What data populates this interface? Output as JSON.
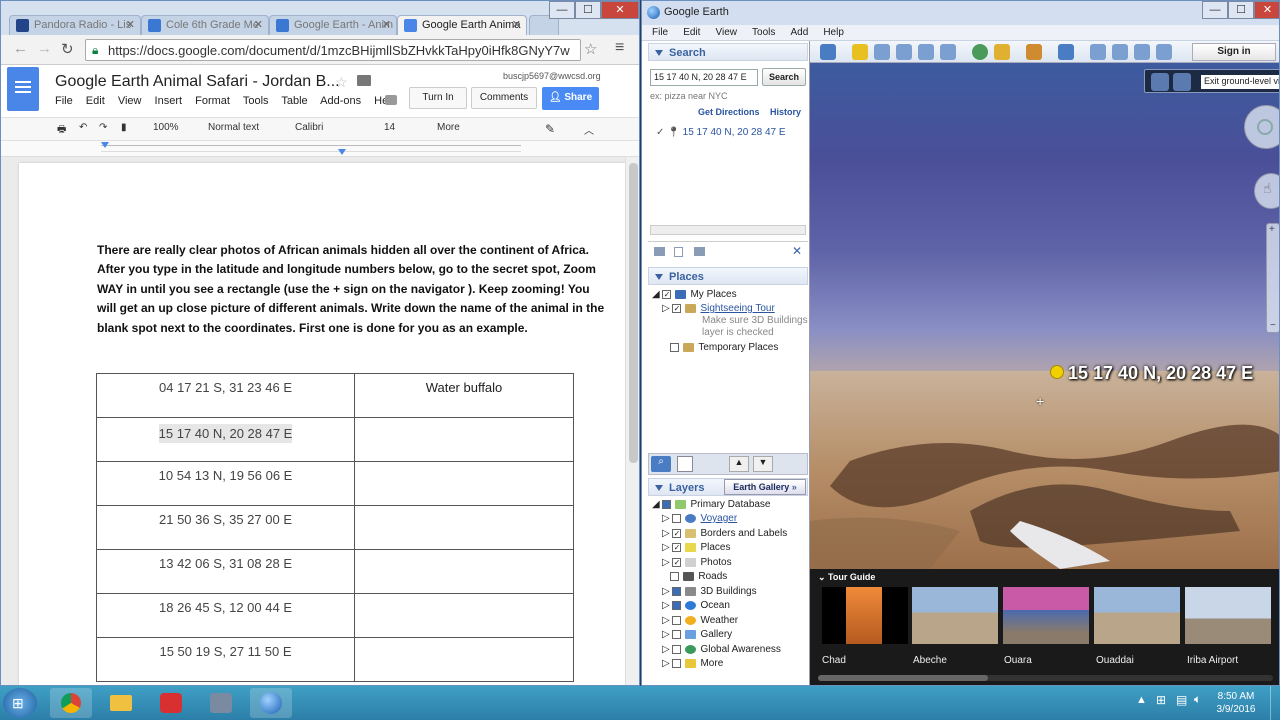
{
  "chrome": {
    "tabs": [
      {
        "label": "Pandora Radio - Lis",
        "color": "#224488"
      },
      {
        "label": "Cole 6th Grade Me",
        "color": "#3b78d4"
      },
      {
        "label": "Google Earth - Anim",
        "color": "#3b78d4"
      },
      {
        "label": "Google Earth Anima",
        "color": "#4a86e8"
      }
    ],
    "url": "https://docs.google.com/document/d/1mzcBHijmllSbZHvkkTaHpy0iHfk8GNyY7w"
  },
  "doc": {
    "title": "Google Earth Animal Safari - Jordan B...",
    "user_email": "buscjp5697@wwcsd.org",
    "menu": [
      "File",
      "Edit",
      "View",
      "Insert",
      "Format",
      "Tools",
      "Table",
      "Add-ons",
      "Hel"
    ],
    "turn_in_label": "Turn In",
    "comments_label": "Comments",
    "share_label": "Share",
    "toolbar": {
      "zoom": "100%",
      "style": "Normal text",
      "font": "Calibri",
      "size": "14",
      "more": "More"
    },
    "instructions": [
      "There are really clear photos of African animals hidden all over the continent of Africa.",
      "After you type in the latitude and longitude numbers below, go to the secret spot, Zoom",
      "WAY in until you see a rectangle (use the + sign on the navigator ). Keep zooming! You",
      "will get an up close picture of different animals.  Write down the name of the animal in the",
      "blank spot next to the coordinates.  First one is done for you as an example."
    ],
    "table_rows": [
      {
        "coord": "04 17 21 S, 31 23 46 E",
        "animal": "Water buffalo"
      },
      {
        "coord": "15 17 40 N, 20 28 47 E",
        "animal": ""
      },
      {
        "coord": "10 54 13 N, 19 56 06 E",
        "animal": ""
      },
      {
        "coord": "21 50 36 S, 35 27 00 E",
        "animal": ""
      },
      {
        "coord": "13 42 06 S, 31 08 28 E",
        "animal": ""
      },
      {
        "coord": "18 26 45 S, 12 00 44 E",
        "animal": ""
      },
      {
        "coord": "15 50 19 S, 27 11 50 E",
        "animal": ""
      }
    ]
  },
  "earth": {
    "title": "Google Earth",
    "menu": [
      "File",
      "Edit",
      "View",
      "Tools",
      "Add",
      "Help"
    ],
    "search_header": "Search",
    "search_value": "15 17 40 N, 20 28 47 E",
    "search_button": "Search",
    "search_hint": "ex: pizza near NYC",
    "get_directions": "Get Directions",
    "history": "History",
    "result": "15 17 40 N, 20 28 47 E",
    "places_header": "Places",
    "my_places": "My Places",
    "sightseeing": "Sightseeing Tour",
    "sightseeing_note1": "Make sure 3D Buildings",
    "sightseeing_note2": "layer is checked",
    "temporary_places": "Temporary Places",
    "layers_header": "Layers",
    "earth_gallery": "Earth Gallery",
    "layers": [
      "Primary Database",
      "Voyager",
      "Borders and Labels",
      "Places",
      "Photos",
      "Roads",
      "3D Buildings",
      "Ocean",
      "Weather",
      "Gallery",
      "Global Awareness",
      "More"
    ],
    "sign_in": "Sign in",
    "exit_ground": "Exit ground-level vi",
    "placemark_label": "15 17 40 N, 20 28 47 E",
    "tour_guide": "Tour Guide",
    "tour_items": [
      "Chad",
      "Abeche",
      "Ouara",
      "Ouaddai",
      "Iriba Airport"
    ]
  },
  "taskbar": {
    "time": "8:50 AM",
    "date": "3/9/2016"
  }
}
